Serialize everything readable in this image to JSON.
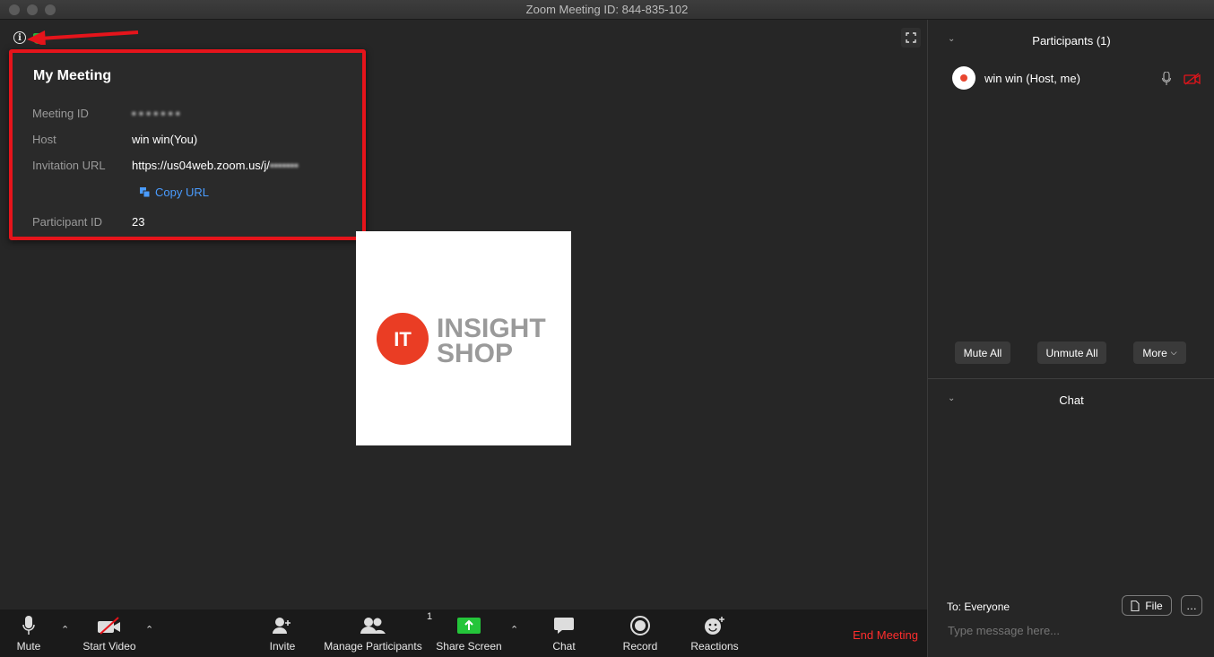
{
  "window": {
    "title": "Zoom Meeting ID: 844-835-102"
  },
  "popup": {
    "title": "My Meeting",
    "meeting_id_label": "Meeting ID",
    "meeting_id_value": "• • • • • • •",
    "host_label": "Host",
    "host_value": "win win(You)",
    "invitation_label": "Invitation URL",
    "invitation_value": "https://us04web.zoom.us/j/",
    "invitation_hidden": "•••••••",
    "copy_url": "Copy URL",
    "participant_id_label": "Participant ID",
    "participant_id_value": "23"
  },
  "video": {
    "logo_mark": "IT",
    "logo_line1": "INSIGHT",
    "logo_line2": "SHOP"
  },
  "toolbar": {
    "mute": "Mute",
    "start_video": "Start Video",
    "invite": "Invite",
    "manage_participants": "Manage Participants",
    "participants_count": "1",
    "share_screen": "Share Screen",
    "chat": "Chat",
    "record": "Record",
    "reactions": "Reactions",
    "end_meeting": "End Meeting"
  },
  "participants": {
    "header": "Participants (1)",
    "list": [
      {
        "name": "win win (Host, me)"
      }
    ],
    "mute_all": "Mute All",
    "unmute_all": "Unmute All",
    "more": "More"
  },
  "chat": {
    "header": "Chat",
    "to": "To: Everyone",
    "file": "File",
    "more": "…",
    "placeholder": "Type message here..."
  },
  "colors": {
    "accent_red": "#e5141b",
    "end_red": "#ff2d2d",
    "link_blue": "#4a9cff",
    "share_green": "#24c53a"
  }
}
